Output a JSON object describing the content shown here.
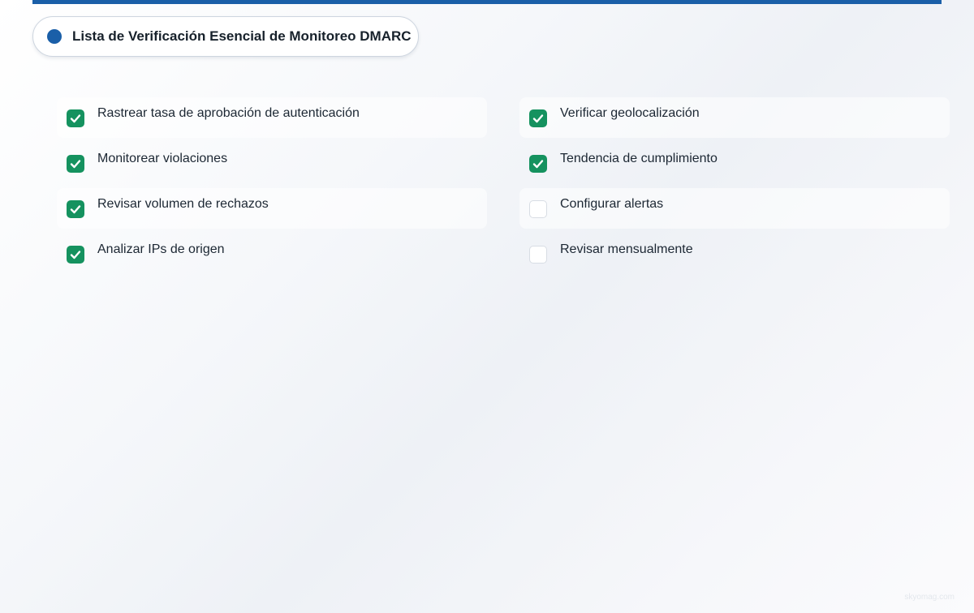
{
  "header": {
    "title": "Lista de Verificación Esencial de Monitoreo DMARC"
  },
  "checklist": {
    "left": [
      {
        "label": "Rastrear tasa de aprobación de autenticación",
        "checked": true
      },
      {
        "label": "Monitorear violaciones",
        "checked": true
      },
      {
        "label": "Revisar volumen de rechazos",
        "checked": true
      },
      {
        "label": "Analizar IPs de origen",
        "checked": true
      }
    ],
    "right": [
      {
        "label": "Verificar geolocalización",
        "checked": true
      },
      {
        "label": "Tendencia de cumplimiento",
        "checked": true
      },
      {
        "label": "Configurar alertas",
        "checked": false
      },
      {
        "label": "Revisar mensualmente",
        "checked": false
      }
    ]
  },
  "footer": {
    "watermark": "skyomag.com"
  },
  "colors": {
    "accent": "#1a5fa8",
    "check": "#15925f",
    "text": "#1c2733"
  }
}
